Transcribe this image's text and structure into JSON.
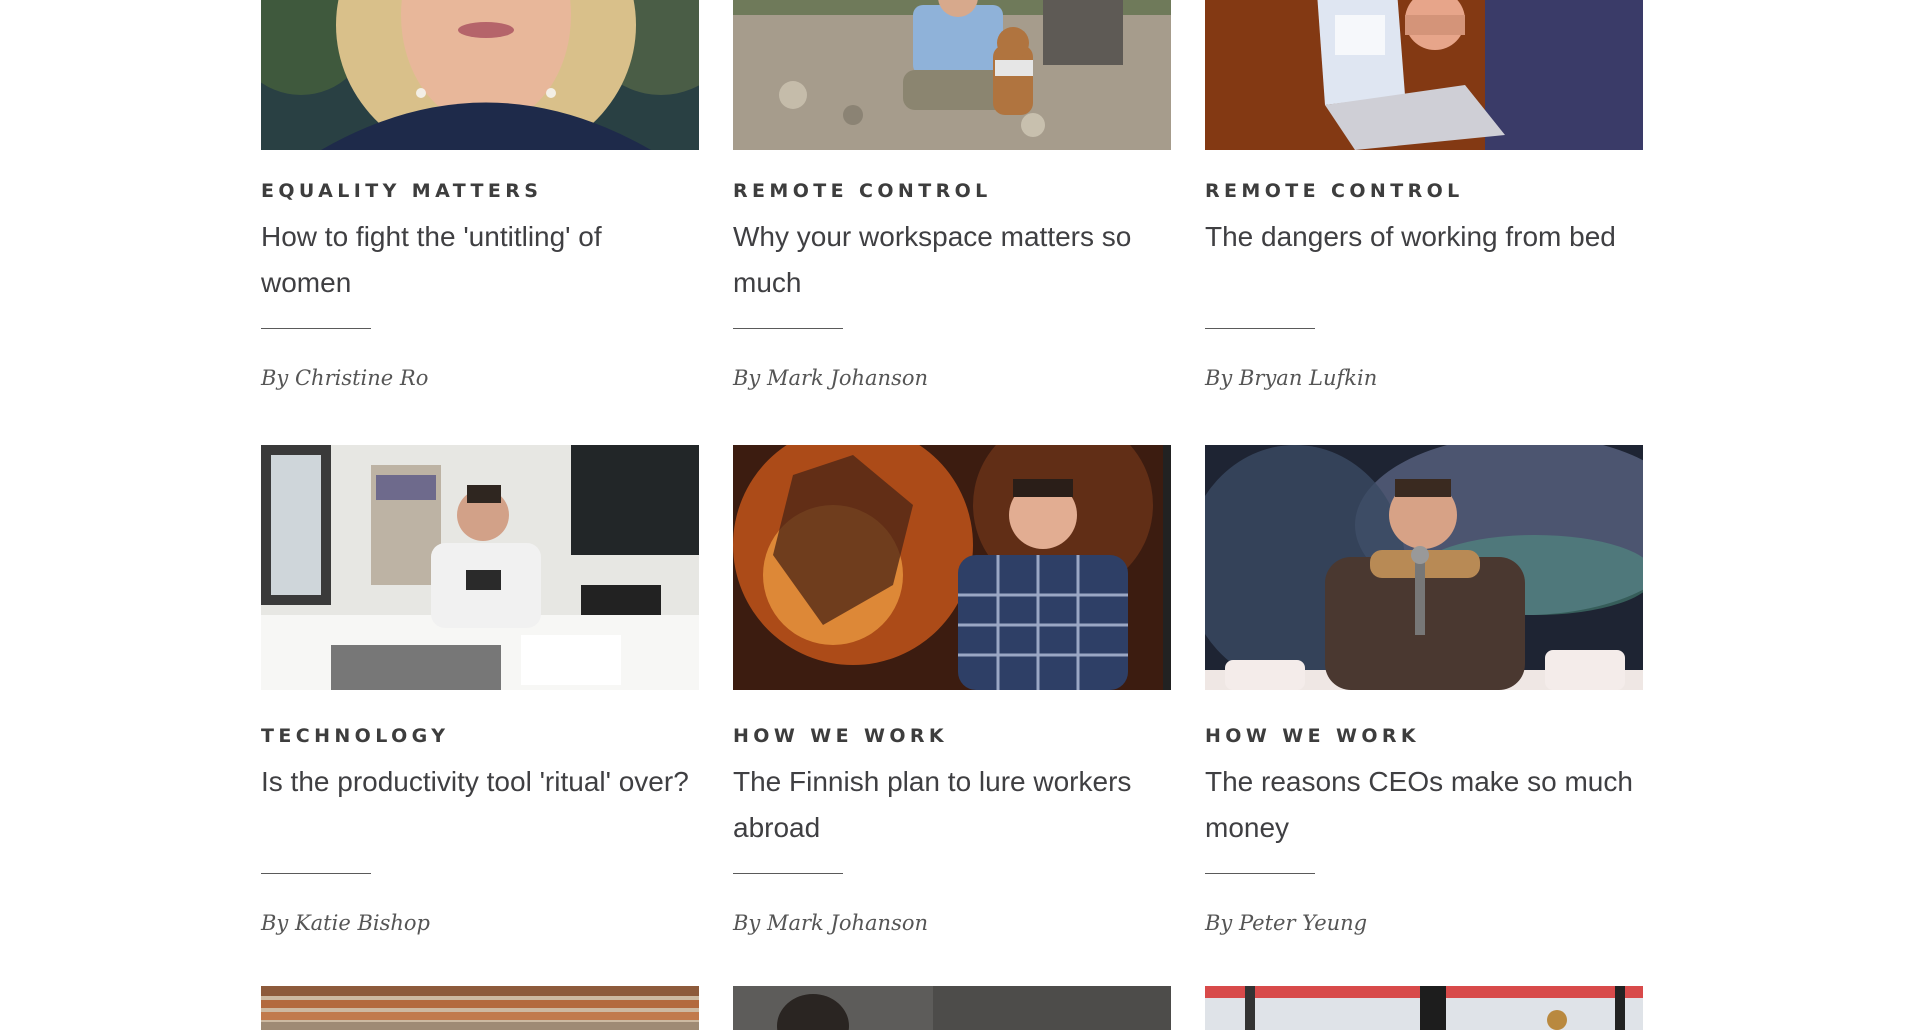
{
  "articles": [
    {
      "kicker": "Equality Matters",
      "title": "How to fight the 'untitling' of women",
      "byline": "By Christine Ro",
      "image": "woman-blonde-portrait-photo"
    },
    {
      "kicker": "Remote Control",
      "title": "Why your workspace matters so much",
      "byline": "By Mark Johanson",
      "image": "man-sitting-with-dog-photo"
    },
    {
      "kicker": "Remote Control",
      "title": "The dangers of working from bed",
      "byline": "By Bryan Lufkin",
      "image": "laptop-on-bed-photo"
    },
    {
      "kicker": "Technology",
      "title": "Is the productivity tool 'ritual' over?",
      "byline": "By Katie Bishop",
      "image": "man-at-desk-with-phone-photo"
    },
    {
      "kicker": "How We Work",
      "title": "The Finnish plan to lure workers abroad",
      "byline": "By Mark Johanson",
      "image": "man-in-front-of-dragon-mural-photo"
    },
    {
      "kicker": "How We Work",
      "title": "The reasons CEOs make so much money",
      "byline": "By Peter Yeung",
      "image": "man-with-microphone-on-stage-photo"
    }
  ],
  "partial_row": [
    {
      "image": "aerial-housing-rooftops-photo"
    },
    {
      "image": "woman-with-braids-photo"
    },
    {
      "image": "office-window-photo"
    }
  ]
}
